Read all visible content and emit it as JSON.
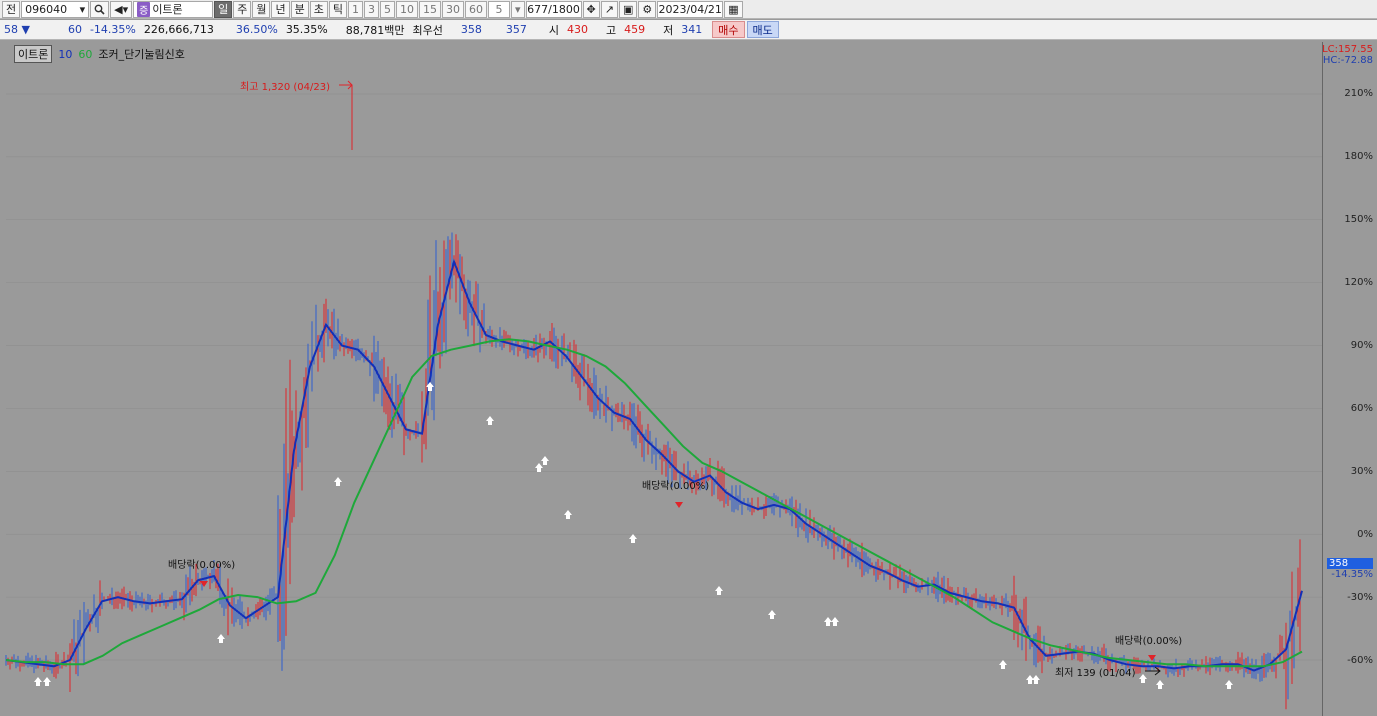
{
  "toolbar": {
    "jeon": "전",
    "code": "096040",
    "stock_name": "이트론",
    "badge": "증",
    "periods": [
      "일",
      "주",
      "월",
      "년",
      "분",
      "초",
      "틱"
    ],
    "nums": [
      "1",
      "3",
      "5",
      "10",
      "15",
      "30",
      "60"
    ],
    "count_value": "5",
    "bars": "677",
    "bars_total": "/1800",
    "date": "2023/04/21"
  },
  "quote": {
    "prev_price": "58 ▼",
    "change": "60",
    "change_pct": "-14.35%",
    "volume": "226,666,713",
    "vol_ratio": "36.50%",
    "turnover": "35.35%",
    "amount": "88,781백만",
    "best_label": "최우선",
    "ask": "358",
    "bid": "357",
    "open_label": "시",
    "open": "430",
    "high_label": "고",
    "high": "459",
    "low_label": "저",
    "low": "341",
    "buy_label": "매수",
    "sell_label": "매도"
  },
  "legend": {
    "name": "이트론",
    "ma1": "10",
    "ma2": "60",
    "indicator": "조커_단기눌림신호"
  },
  "axis": {
    "lc": "LC:157.55",
    "hc": "HC:-72.88",
    "ticks": [
      "210%",
      "180%",
      "150%",
      "120%",
      "90%",
      "60%",
      "30%",
      "0%",
      "-30%",
      "-60%"
    ],
    "current_price": "358",
    "current_pct": "-14.35%"
  },
  "annotations": {
    "high": "최고 1,320 (04/23)",
    "low": "최저 139 (01/04)",
    "div1": "배당락(0.00%)",
    "div2": "배당락(0.00%)",
    "div3": "배당락(0.00%)"
  },
  "colors": {
    "up": "#e0242a",
    "down": "#2f5fd0",
    "ma10": "#1230b8",
    "ma60": "#1ea83a"
  },
  "chart_data": {
    "type": "line",
    "y_unit": "%",
    "ylim": [
      -72.88,
      157.55
    ],
    "series": [
      {
        "name": "10",
        "values": [
          -60,
          -61,
          -62,
          -63,
          -60,
          -45,
          -32,
          -30,
          -32,
          -33,
          -32,
          -31,
          -22,
          -20,
          -34,
          -40,
          -35,
          -30,
          40,
          80,
          100,
          90,
          88,
          80,
          65,
          50,
          48,
          100,
          130,
          110,
          95,
          92,
          90,
          88,
          92,
          85,
          75,
          65,
          58,
          55,
          45,
          38,
          30,
          25,
          28,
          20,
          15,
          12,
          14,
          12,
          5,
          0,
          -5,
          -10,
          -15,
          -18,
          -22,
          -25,
          -24,
          -28,
          -30,
          -32,
          -33,
          -35,
          -50,
          -58,
          -57,
          -56,
          -57,
          -60,
          -62,
          -63,
          -63,
          -64,
          -63,
          -63,
          -62,
          -62,
          -65,
          -62,
          -55,
          -27
        ]
      },
      {
        "name": "60",
        "values": [
          -60,
          -61,
          -61,
          -62,
          -62,
          -58,
          -52,
          -48,
          -44,
          -40,
          -36,
          -31,
          -29,
          -30,
          -33,
          -32,
          -28,
          -10,
          15,
          35,
          55,
          75,
          85,
          88,
          90,
          92,
          93,
          92,
          90,
          88,
          85,
          80,
          72,
          62,
          52,
          42,
          34,
          30,
          25,
          20,
          15,
          10,
          5,
          0,
          -5,
          -10,
          -15,
          -20,
          -25,
          -30,
          -36,
          -42,
          -46,
          -50,
          -53,
          -55,
          -57,
          -59,
          -60,
          -61,
          -62,
          -62,
          -63,
          -63,
          -63,
          -63,
          -61,
          -56
        ]
      }
    ]
  }
}
